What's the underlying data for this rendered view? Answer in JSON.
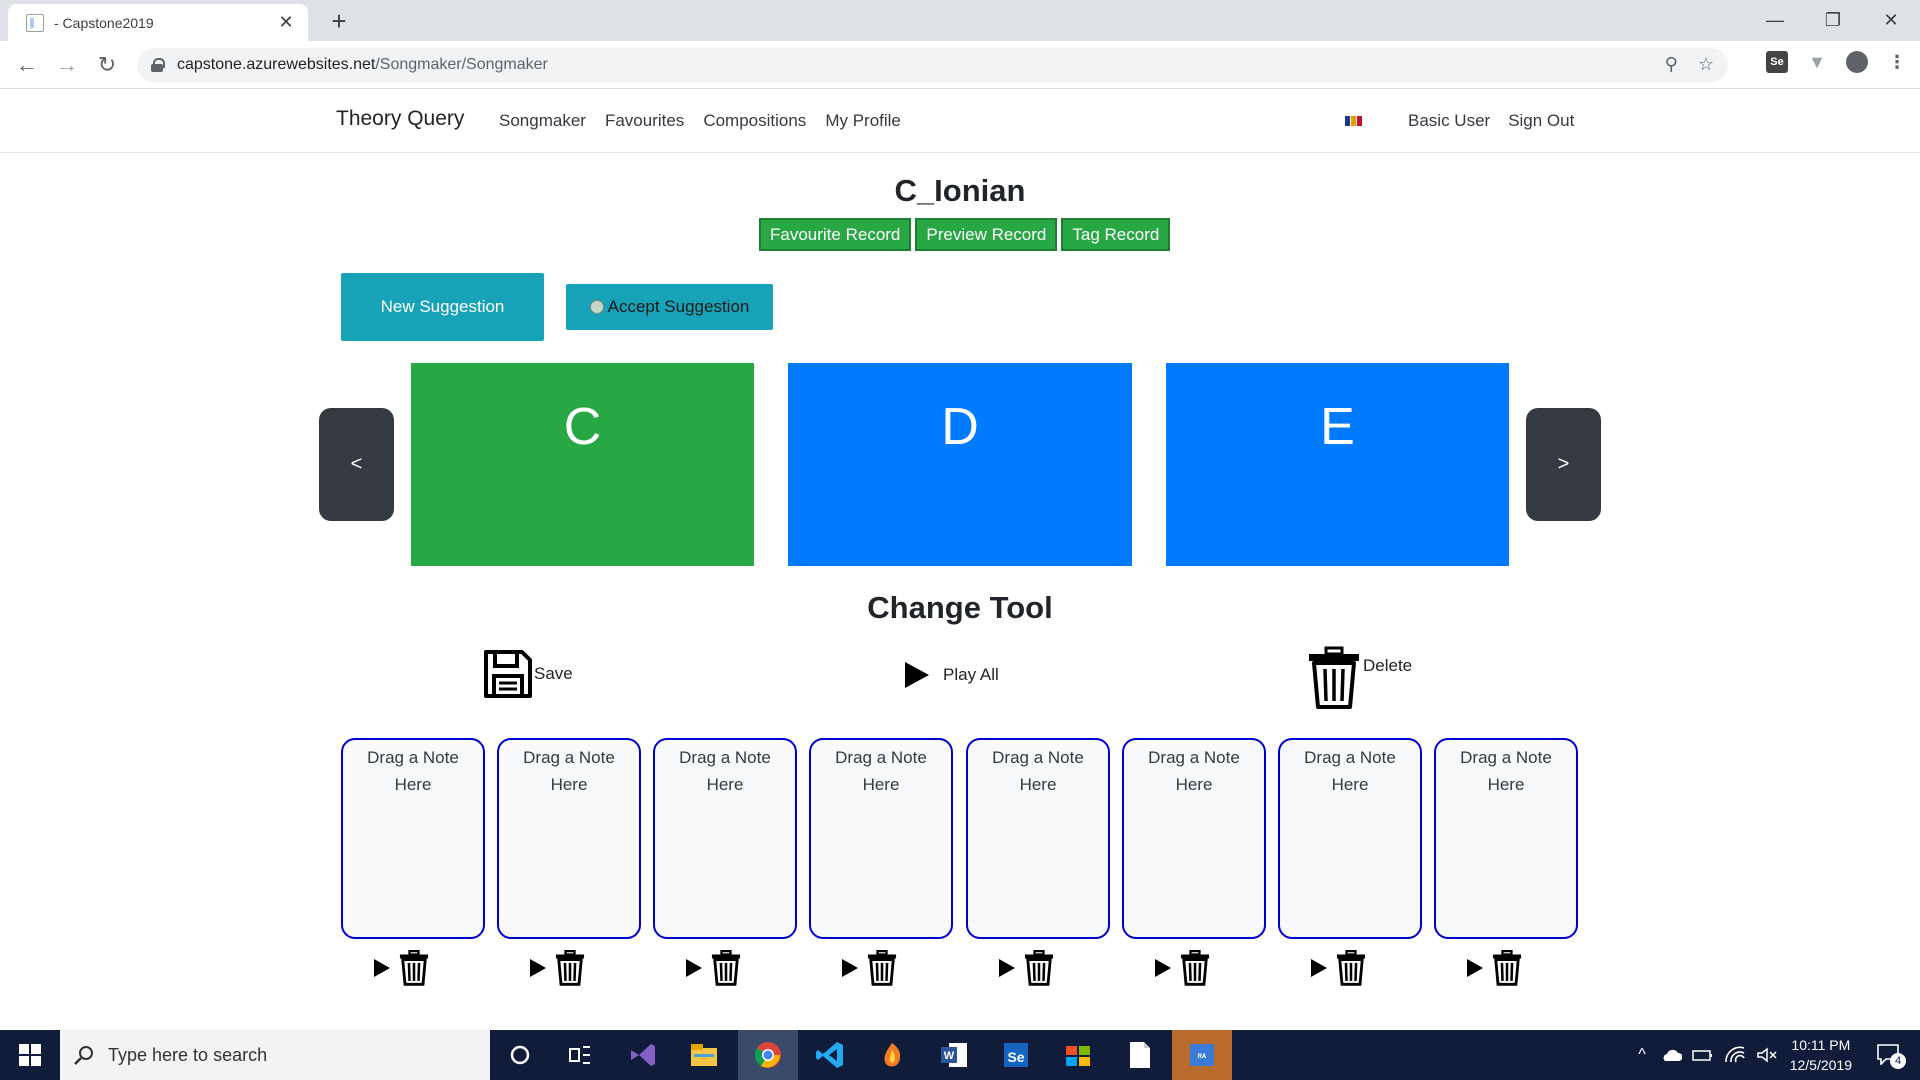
{
  "browser": {
    "tab_title": "- Capstone2019",
    "url_host": "capstone.azurewebsites.net",
    "url_path": "/Songmaker/Songmaker"
  },
  "navbar": {
    "brand": "Theory Query",
    "links": [
      "Songmaker",
      "Favourites",
      "Compositions",
      "My Profile"
    ],
    "user_label": "Basic User",
    "signout_label": "Sign Out"
  },
  "record": {
    "title": "C_Ionian",
    "buttons": [
      "Favourite Record",
      "Preview Record",
      "Tag Record"
    ]
  },
  "suggestion": {
    "new_label": "New Suggestion",
    "accept_label": "Accept Suggestion"
  },
  "carousel": {
    "prev_label": "<",
    "next_label": ">",
    "notes": [
      {
        "label": "C",
        "color": "#28a745"
      },
      {
        "label": "D",
        "color": "#007bff"
      },
      {
        "label": "E",
        "color": "#007bff"
      }
    ]
  },
  "tools": {
    "heading": "Change Tool",
    "save_label": "Save",
    "play_all_label": "Play All",
    "delete_label": "Delete"
  },
  "slots": [
    "Drag a Note Here",
    "Drag a Note Here",
    "Drag a Note Here",
    "Drag a Note Here",
    "Drag a Note Here",
    "Drag a Note Here",
    "Drag a Note Here",
    "Drag a Note Here"
  ],
  "taskbar": {
    "search_placeholder": "Type here to search",
    "time": "10:11 PM",
    "date": "12/5/2019",
    "notification_count": "4"
  }
}
